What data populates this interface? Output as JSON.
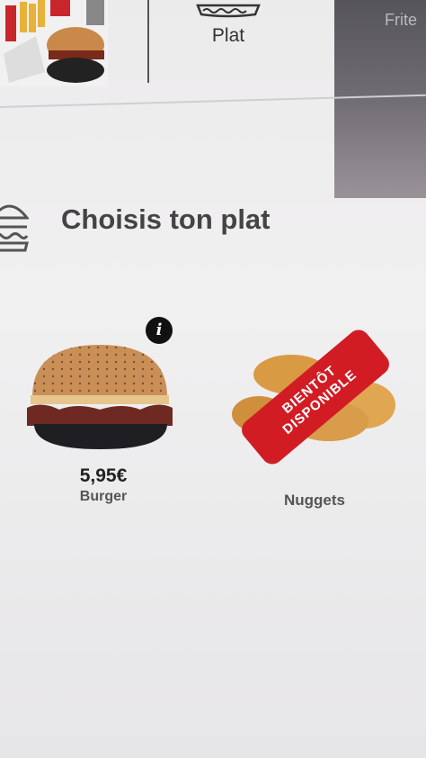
{
  "categories": {
    "active_label": "Plat",
    "next_label": "Frite"
  },
  "section": {
    "title": "Choisis ton plat"
  },
  "products": [
    {
      "name": "Burger",
      "price": "5,95€",
      "available": true
    },
    {
      "name": "Nuggets",
      "available": false,
      "badge_line1": "BIENTÔT",
      "badge_line2": "DISPONIBLE"
    }
  ],
  "colors": {
    "badge": "#d21c24",
    "title": "#444444",
    "background": "#ecebec"
  },
  "icons": [
    "burger-outline-icon",
    "plate-icon",
    "info-icon"
  ]
}
